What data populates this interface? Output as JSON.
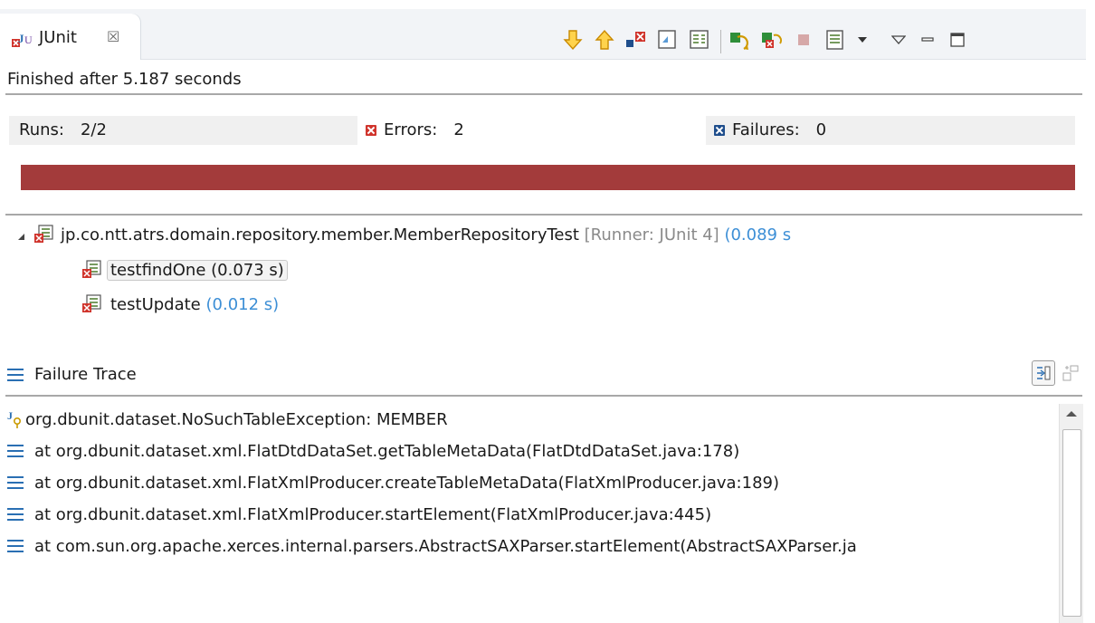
{
  "tab": {
    "title": "JUnit",
    "close_glyph": "☒"
  },
  "toolbar": {
    "icons": [
      "next-failure-icon",
      "previous-failure-icon",
      "show-failures-only-icon",
      "scroll-lock-icon",
      "show-skipped-icon",
      "rerun-test-icon",
      "rerun-failed-first-icon",
      "stop-icon",
      "test-history-icon",
      "history-dropdown-icon",
      "view-menu-icon",
      "minimize-icon",
      "maximize-icon"
    ]
  },
  "status": "Finished after 5.187 seconds",
  "counters": {
    "runs_label": "Runs:",
    "runs_value": "2/2",
    "errors_label": "Errors:",
    "errors_value": "2",
    "failures_label": "Failures:",
    "failures_value": "0"
  },
  "progress": {
    "fraction": 1.0,
    "color": "#a33b3b"
  },
  "tree": {
    "suite": {
      "name": "jp.co.ntt.atrs.domain.repository.member.MemberRepositoryTest",
      "runner": "[Runner: JUnit 4]",
      "time": "(0.089 s"
    },
    "tests": [
      {
        "name": "testfindOne",
        "time": "(0.073 s)"
      },
      {
        "name": "testUpdate",
        "time": "(0.012 s)"
      }
    ]
  },
  "trace": {
    "header": "Failure Trace",
    "lines": [
      "org.dbunit.dataset.NoSuchTableException: MEMBER",
      "at org.dbunit.dataset.xml.FlatDtdDataSet.getTableMetaData(FlatDtdDataSet.java:178)",
      "at org.dbunit.dataset.xml.FlatXmlProducer.createTableMetaData(FlatXmlProducer.java:189)",
      "at org.dbunit.dataset.xml.FlatXmlProducer.startElement(FlatXmlProducer.java:445)",
      "at com.sun.org.apache.xerces.internal.parsers.AbstractSAXParser.startElement(AbstractSAXParser.ja"
    ]
  },
  "colors": {
    "error_red": "#d0342c",
    "failure_blue": "#1f4e8c",
    "time_blue": "#3d8fd6",
    "runner_gray": "#8a8a8a"
  }
}
